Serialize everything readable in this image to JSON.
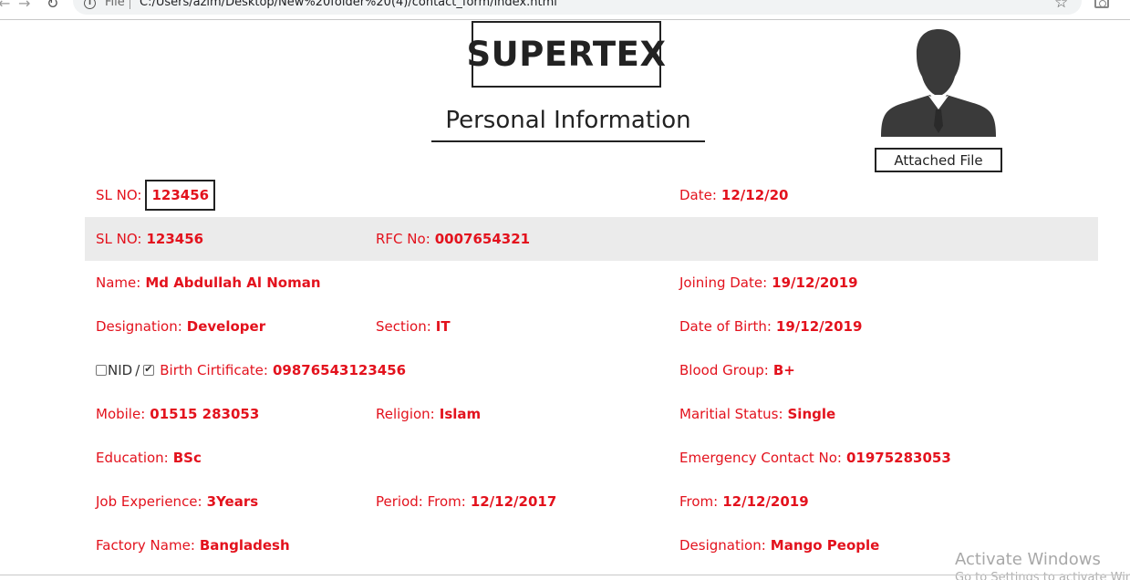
{
  "browser": {
    "back_icon": "←",
    "forward_icon": "→",
    "reload_icon": "↻",
    "scheme": "File",
    "url": "C:/Users/azim/Desktop/New%20folder%20(4)/contact_form/index.html",
    "star_icon": "☆"
  },
  "header": {
    "logo": "SUPERTEX",
    "title": "Personal Information",
    "attached_file": "Attached File"
  },
  "rows": {
    "r0": {
      "sl_label": "SL NO:",
      "sl_value": "123456",
      "date_label": "Date:",
      "date_value": "12/12/20"
    },
    "r1": {
      "sl_label": "SL NO:",
      "sl_value": "123456",
      "rfc_label": "RFC No:",
      "rfc_value": "0007654321"
    },
    "r2": {
      "name_label": "Name:",
      "name_value": "Md Abdullah Al Noman",
      "joining_label": "Joining Date:",
      "joining_value": "19/12/2019"
    },
    "r3": {
      "designation_label": "Designation:",
      "designation_value": "Developer",
      "section_label": "Section:",
      "section_value": "IT",
      "dob_label": "Date of Birth:",
      "dob_value": "19/12/2019"
    },
    "r4": {
      "nid_label": "NID",
      "separator": "/",
      "bc_label": "Birth Cirtificate:",
      "bc_value": "09876543123456",
      "blood_label": "Blood Group:",
      "blood_value": "B+"
    },
    "r5": {
      "mobile_label": "Mobile:",
      "mobile_value": "01515 283053",
      "religion_label": "Religion:",
      "religion_value": "Islam",
      "marital_label": "Maritial Status:",
      "marital_value": "Single"
    },
    "r6": {
      "education_label": "Education:",
      "education_value": "BSc",
      "emergency_label": "Emergency Contact No:",
      "emergency_value": "01975283053"
    },
    "r7": {
      "experience_label": "Job Experience:",
      "experience_value": "3Years",
      "period_label": "Period: From:",
      "period_value": "12/12/2017",
      "from_label": "From:",
      "from_value": "12/12/2019"
    },
    "r8": {
      "factory_label": "Factory Name:",
      "factory_value": "Bangladesh",
      "designation_label": "Designation:",
      "designation_value": "Mango People"
    }
  },
  "nid_checked": false,
  "birth_certificate_checked": true,
  "watermark": {
    "title": "Activate Windows",
    "subtitle": "Go to Settings to activate Windows."
  },
  "colors": {
    "accent_red": "#e3121d",
    "shaded_row": "#ebebeb"
  }
}
